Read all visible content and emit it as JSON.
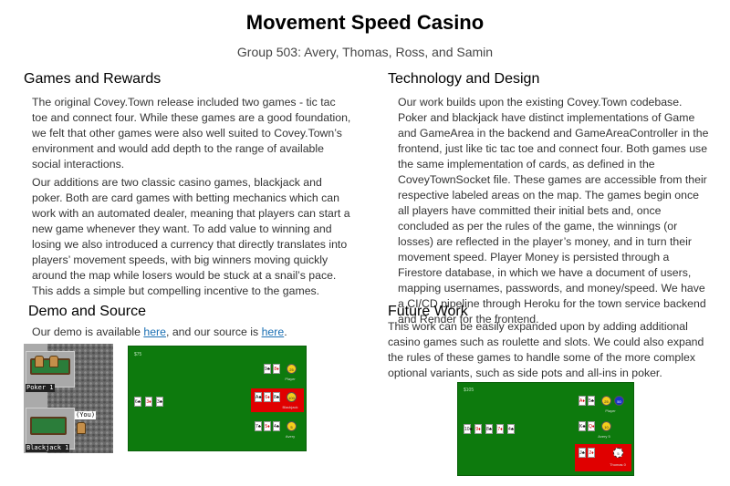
{
  "header": {
    "title": "Movement Speed Casino",
    "subtitle": "Group 503: Avery, Thomas, Ross, and Samin"
  },
  "games_rewards": {
    "heading": "Games and Rewards",
    "p1": "The original Covey.Town release included two games - tic tac toe and connect four. While these games are a good foundation, we felt that other games were also well suited to Covey.Town’s environment and would add depth to the range of available social interactions.",
    "p2": "Our additions are two classic casino games, blackjack and poker. Both are card games with betting mechanics which can work with an automated dealer, meaning that players can start a new game whenever they want. To add value to winning and losing we also introduced a currency that directly translates into players’ movement speeds, with big winners moving quickly around the map while losers would be stuck at a snail’s pace. This adds a simple but compelling incentive to the games."
  },
  "demo_source": {
    "heading": "Demo and Source",
    "text_before": "Our demo is available ",
    "link_demo": "here",
    "text_middle": ", and our source is ",
    "link_source": "here",
    "text_after": "."
  },
  "tech_design": {
    "heading": "Technology and Design",
    "p1": "Our work builds upon the existing Covey.Town codebase. Poker and blackjack have distinct implementations of Game and GameArea in the backend and GameAreaController in the frontend, just like tic tac toe and connect four. Both games use the same implementation of cards, as defined in the CoveyTownSocket file. These games are accessible from their respective labeled areas on the map. The games begin once all players have committed their initial bets and, once concluded as per the rules of the game, the winnings (or losses) are reflected in the player’s money, and in turn their movement speed. Player Money is persisted through a Firestore database, in which we have a document of users, mapping usernames, passwords, and money/speed. We have a CI/CD pipeline through Heroku for the town service backend and Render for the frontend."
  },
  "future_work": {
    "heading": "Future Work",
    "p1": "This work can be easily expanded upon by adding additional casino games such as roulette and slots. We could also expand the rules of these games to handle some of the more complex optional variants, such as side pots and all-ins in poker."
  },
  "map_image": {
    "label_poker": "Poker 1",
    "label_blackjack": "Blackjack 1",
    "label_you": "(You)"
  },
  "blackjack_board": {
    "money": "$75",
    "dealer_cards": [
      "6♣",
      "3♦",
      "3♣"
    ],
    "seats": [
      {
        "cards": [
          "9♣",
          "8♦"
        ],
        "chip": "25",
        "name": "Player"
      },
      {
        "cards": [
          "A♣",
          "6♦",
          "8♣"
        ],
        "chip": "100",
        "name": "Blackjack",
        "highlight": true
      },
      {
        "cards": [
          "7♣",
          "5♦",
          "4♣"
        ],
        "chip": "5",
        "name": "Avery"
      }
    ]
  },
  "poker_board": {
    "money": "$105",
    "community_cards": [
      "10♣",
      "9♦",
      "8♣",
      "7♦",
      "4♣"
    ],
    "seats": [
      {
        "cards": [
          "A♦",
          "5♣"
        ],
        "chips": [
          "25",
          "50"
        ],
        "name": "Player"
      },
      {
        "cards": [
          "K♣",
          "Q♦"
        ],
        "chips": [
          "10"
        ],
        "name": "Avery 5"
      },
      {
        "cards": [
          "J♣",
          "2♦"
        ],
        "chips": [
          "5"
        ],
        "name": "Thomas 0",
        "highlight": true
      }
    ]
  },
  "colors": {
    "table_green": "#0d7a0d",
    "highlight_red": "#e00000",
    "chip_yellow": "#f5cf1a",
    "chip_blue": "#1a33c9",
    "link_blue": "#1a6fb3"
  }
}
